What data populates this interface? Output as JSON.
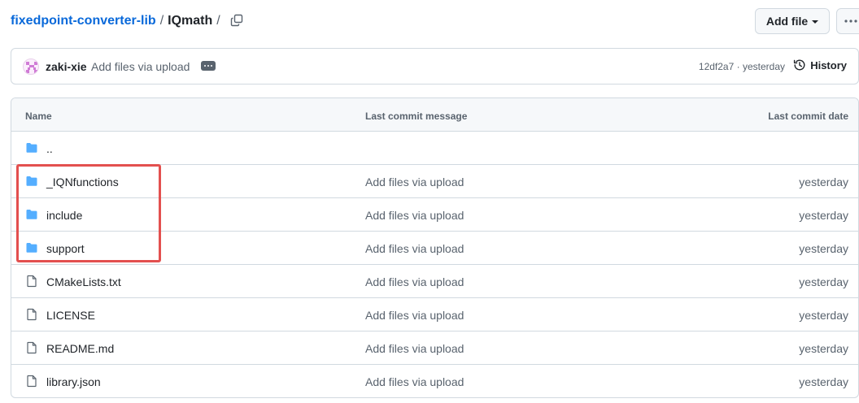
{
  "breadcrumb": {
    "repo": "fixedpoint-converter-lib",
    "separator": "/",
    "current": "IQmath",
    "trailing_separator": "/"
  },
  "toolbar": {
    "add_file_label": "Add file",
    "copy_icon": "copy-icon",
    "more_icon": "kebab-horizontal-icon"
  },
  "commit": {
    "author": "zaki-xie",
    "message": "Add files via upload",
    "sha": "12df2a7",
    "meta_separator": "·",
    "time": "yesterday",
    "history_label": "History"
  },
  "table": {
    "columns": {
      "name": "Name",
      "message": "Last commit message",
      "date": "Last commit date"
    },
    "rows": [
      {
        "name": "..",
        "type": "folder",
        "message": "",
        "date": ""
      },
      {
        "name": "_IQNfunctions",
        "type": "folder",
        "message": "Add files via upload",
        "date": "yesterday"
      },
      {
        "name": "include",
        "type": "folder",
        "message": "Add files via upload",
        "date": "yesterday"
      },
      {
        "name": "support",
        "type": "folder",
        "message": "Add files via upload",
        "date": "yesterday"
      },
      {
        "name": "CMakeLists.txt",
        "type": "file",
        "message": "Add files via upload",
        "date": "yesterday"
      },
      {
        "name": "LICENSE",
        "type": "file",
        "message": "Add files via upload",
        "date": "yesterday"
      },
      {
        "name": "README.md",
        "type": "file",
        "message": "Add files via upload",
        "date": "yesterday"
      },
      {
        "name": "library.json",
        "type": "file",
        "message": "Add files via upload",
        "date": "yesterday"
      }
    ]
  },
  "colors": {
    "link": "#0969da",
    "folder": "#54aeff",
    "highlight": "#e3504f",
    "muted": "#59636e"
  }
}
